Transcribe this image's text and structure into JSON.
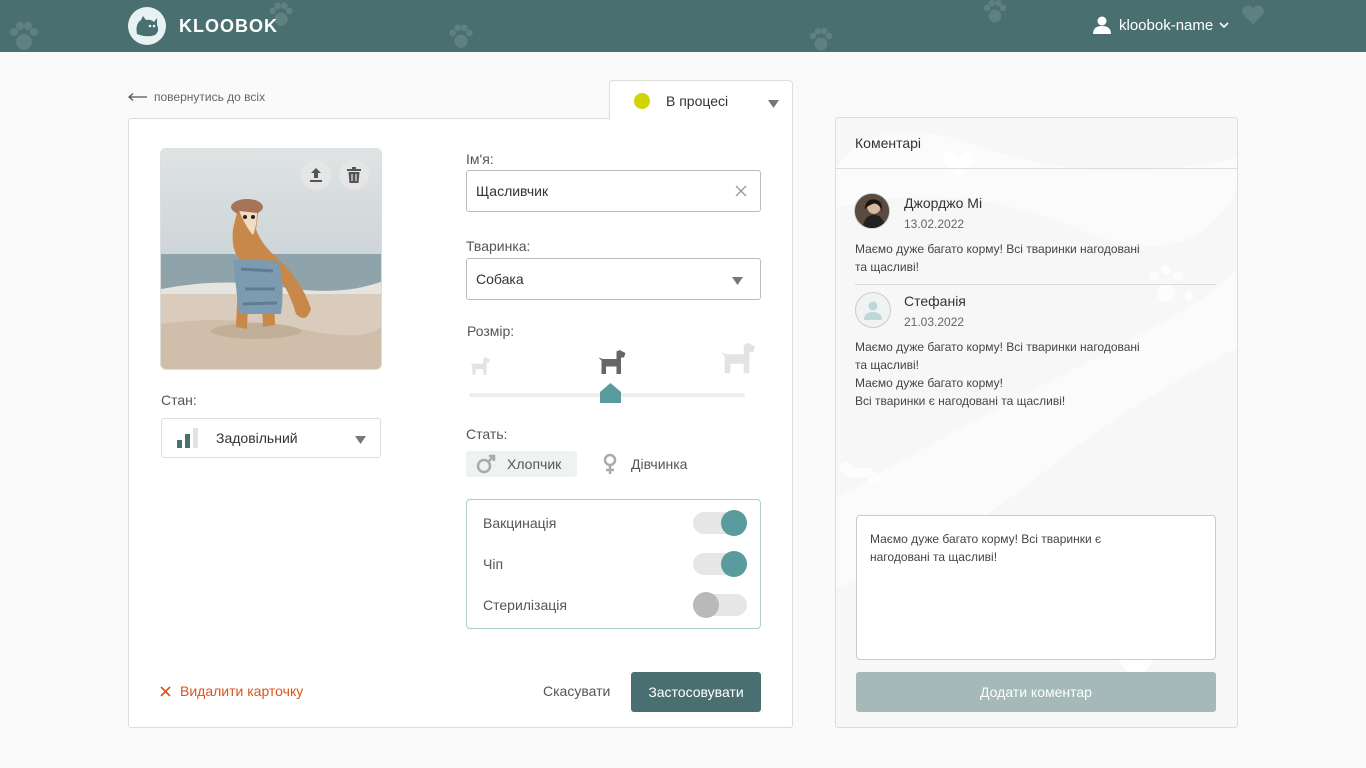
{
  "app": {
    "brand": "KLOOBOK"
  },
  "header": {
    "username": "kloobok-name"
  },
  "back_link": "повернутись до всіх",
  "status": {
    "label": "В процесі",
    "color": "#d2d400"
  },
  "pet": {
    "condition_label": "Стан:",
    "condition_value": "Задовільний",
    "name_label": "Ім'я:",
    "name_value": "Щасливчик",
    "animal_label": "Тваринка:",
    "animal_value": "Собака",
    "size_label": "Розмір:",
    "size_options": [
      "small",
      "medium",
      "large"
    ],
    "size_selected": "medium",
    "gender_label": "Стать:",
    "gender_male": "Хлопчик",
    "gender_female": "Дівчинка",
    "gender_selected": "male",
    "toggles": [
      {
        "label": "Вакцинація",
        "on": true
      },
      {
        "label": "Чіп",
        "on": true
      },
      {
        "label": "Стерилізація",
        "on": false
      }
    ]
  },
  "actions": {
    "delete": "Видалити карточку",
    "cancel": "Скасувати",
    "apply": "Застосовувати"
  },
  "comments": {
    "title": "Коментарі",
    "items": [
      {
        "author": "Джорджо Мі",
        "date": "13.02.2022",
        "lines": [
          "Маємо дуже багато корму! Всі тваринки нагодовані",
          "та щасливі!"
        ]
      },
      {
        "author": "Стефанія",
        "date": "21.03.2022",
        "lines": [
          "Маємо дуже багато корму! Всі тваринки нагодовані",
          "та щасливі!",
          "Маємо дуже багато корму!",
          "Всі тваринки є нагодовані та щасливі!"
        ]
      }
    ],
    "draft_lines": [
      "Маємо дуже багато корму! Всі тваринки є",
      "нагодовані та щасливі!"
    ],
    "add_button": "Додати коментар"
  },
  "colors": {
    "header_bg": "#4a6f70",
    "accent": "#5a9b9e",
    "danger": "#d9541b",
    "status_in_progress": "#d2d400"
  }
}
